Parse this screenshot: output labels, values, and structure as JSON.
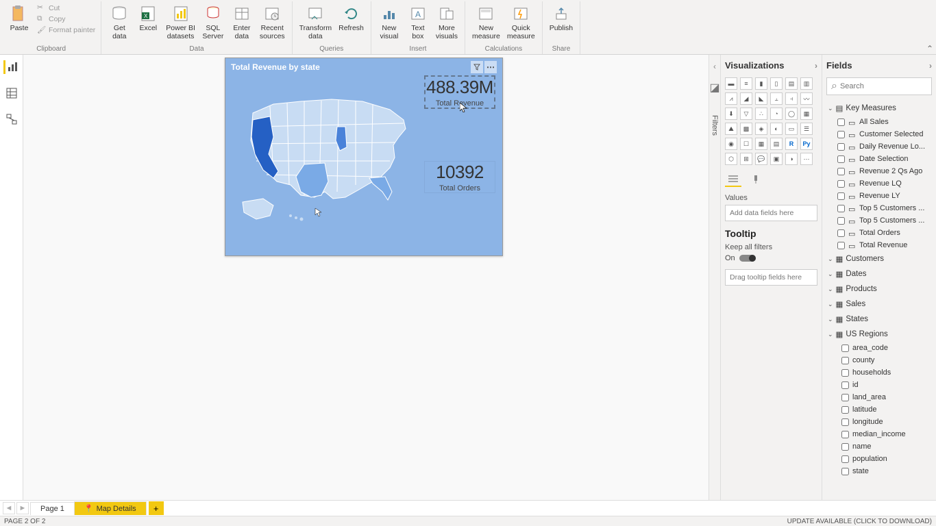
{
  "ribbon": {
    "clipboard": {
      "paste": "Paste",
      "cut": "Cut",
      "copy": "Copy",
      "format": "Format painter",
      "label": "Clipboard"
    },
    "data": {
      "getdata": "Get\ndata",
      "excel": "Excel",
      "pbi": "Power BI\ndatasets",
      "sql": "SQL\nServer",
      "enter": "Enter\ndata",
      "recent": "Recent\nsources",
      "label": "Data"
    },
    "queries": {
      "transform": "Transform\ndata",
      "refresh": "Refresh",
      "label": "Queries"
    },
    "insert": {
      "newvis": "New\nvisual",
      "textbox": "Text\nbox",
      "more": "More\nvisuals",
      "label": "Insert"
    },
    "calc": {
      "newmeasure": "New\nmeasure",
      "quick": "Quick\nmeasure",
      "label": "Calculations"
    },
    "share": {
      "publish": "Publish",
      "label": "Share"
    }
  },
  "visual": {
    "title": "Total Revenue by state",
    "card1_value": "488.39M",
    "card1_label": "Total Revenue",
    "card2_value": "10392",
    "card2_label": "Total Orders"
  },
  "viz_pane": {
    "title": "Visualizations",
    "values_label": "Values",
    "values_placeholder": "Add data fields here",
    "tooltip_title": "Tooltip",
    "keep_filters": "Keep all filters",
    "toggle_state": "On",
    "drag_placeholder": "Drag tooltip fields here"
  },
  "filters_label": "Filters",
  "fields_pane": {
    "title": "Fields",
    "search_placeholder": "Search",
    "tables": {
      "key_measures": {
        "name": "Key Measures",
        "expanded": true,
        "items": [
          "All Sales",
          "Customer Selected",
          "Daily Revenue Lo...",
          "Date Selection",
          "Revenue 2 Qs Ago",
          "Revenue LQ",
          "Revenue LY",
          "Top 5 Customers ...",
          "Top 5 Customers ...",
          "Total Orders",
          "Total Revenue"
        ]
      },
      "customers": {
        "name": "Customers",
        "expanded": false
      },
      "dates": {
        "name": "Dates",
        "expanded": false
      },
      "products": {
        "name": "Products",
        "expanded": false
      },
      "sales": {
        "name": "Sales",
        "expanded": false
      },
      "states": {
        "name": "States",
        "expanded": false
      },
      "us_regions": {
        "name": "US Regions",
        "expanded": true,
        "items": [
          "area_code",
          "county",
          "households",
          "id",
          "land_area",
          "latitude",
          "longitude",
          "median_income",
          "name",
          "population",
          "state"
        ]
      }
    }
  },
  "pages": {
    "page1": "Page 1",
    "page2": "Map Details",
    "info": "PAGE 2 OF 2",
    "update": "UPDATE AVAILABLE (CLICK TO DOWNLOAD)"
  }
}
